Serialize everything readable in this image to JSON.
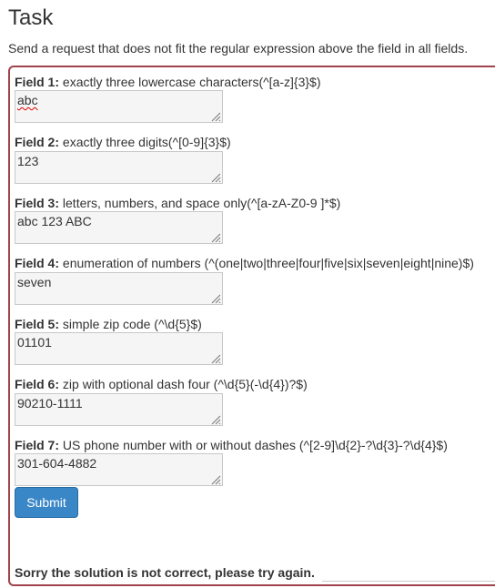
{
  "page": {
    "title": "Task",
    "description": "Send a request that does not fit the regular expression above the field in all fields."
  },
  "fields": [
    {
      "label": "Field 1:",
      "desc": " exactly three lowercase characters(^[a-z]{3}$)",
      "value": "abc"
    },
    {
      "label": "Field 2:",
      "desc": " exactly three digits(^[0-9]{3}$)",
      "value": "123"
    },
    {
      "label": "Field 3:",
      "desc": " letters, numbers, and space only(^[a-zA-Z0-9 ]*$)",
      "value": "abc 123 ABC"
    },
    {
      "label": "Field 4:",
      "desc": " enumeration of numbers (^(one|two|three|four|five|six|seven|eight|nine)$)",
      "value": "seven"
    },
    {
      "label": "Field 5:",
      "desc": " simple zip code (^\\d{5}$)",
      "value": "01101"
    },
    {
      "label": "Field 6:",
      "desc": " zip with optional dash four (^\\d{5}(-\\d{4})?$)",
      "value": "90210-1111"
    },
    {
      "label": "Field 7:",
      "desc": " US phone number with or without dashes (^[2-9]\\d{2}-?\\d{3}-?\\d{4}$)",
      "value": "301-604-4882"
    }
  ],
  "submit_label": "Submit",
  "result_message": "Sorry the solution is not correct, please try again."
}
